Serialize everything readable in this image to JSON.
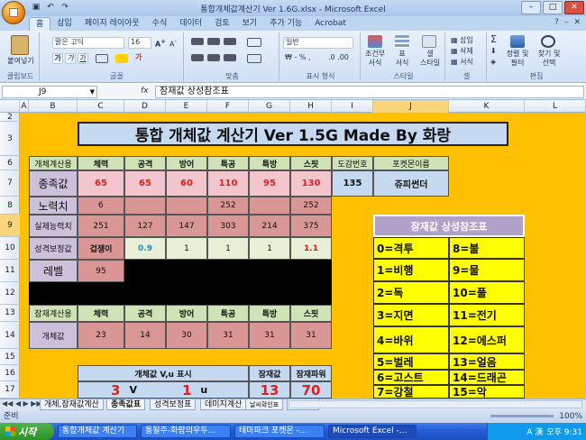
{
  "window": {
    "title": "통합개체값계산기 Ver 1.6G.xlsx - Microsoft Excel"
  },
  "ribbon": {
    "tabs": [
      "홈",
      "삽입",
      "페이지 레이아웃",
      "수식",
      "데이터",
      "검토",
      "보기",
      "추가 기능",
      "Acrobat"
    ],
    "active_tab": "홈",
    "clipboard": {
      "paste": "붙여넣기",
      "label": "클립보드"
    },
    "font": {
      "name": "맑은 고딕",
      "size": "16",
      "label": "글꼴"
    },
    "alignment": {
      "label": "맞춤"
    },
    "number": {
      "format": "일반",
      "label": "표시 형식"
    },
    "style": {
      "conditional": "조건부\n서식",
      "table": "표\n서식",
      "cell": "셀\n스타일",
      "label": "스타일"
    },
    "cells": {
      "insert": "삽입",
      "delete": "삭제",
      "format": "서식",
      "label": "셀"
    },
    "edit": {
      "sort": "정렬 및\n필터",
      "find": "찾기 및\n선택",
      "label": "편집"
    }
  },
  "formula_bar": {
    "cell_ref": "J9",
    "fx": "fx",
    "content": "잠재값 상성참조표"
  },
  "columns": [
    "A",
    "B",
    "C",
    "D",
    "E",
    "F",
    "G",
    "H",
    "I",
    "J",
    "K",
    "L"
  ],
  "selected_column": "J",
  "rows": [
    "2",
    "3",
    "6",
    "7",
    "8",
    "9",
    "10",
    "11",
    "12",
    "13",
    "14",
    "15",
    "16",
    "17"
  ],
  "selected_row": "9",
  "sheet": {
    "title": "통합 개체값 계산기   Ver 1.5G   Made By 화랑",
    "header_row": {
      "label": "개체계산용",
      "cols": [
        "체력",
        "공격",
        "방어",
        "특공",
        "특방",
        "스핏"
      ],
      "dex_no": "도감번호",
      "poke_name": "포켓몬이름"
    },
    "species": {
      "label": "종족값",
      "values": [
        "65",
        "65",
        "60",
        "110",
        "95",
        "130"
      ],
      "dex_no": "135",
      "poke_name": "쥬피썬더"
    },
    "effort": {
      "label": "노력치",
      "values": [
        "6",
        "",
        "",
        "252",
        "",
        "252"
      ]
    },
    "actual": {
      "label": "실제능력치",
      "values": [
        "251",
        "127",
        "147",
        "303",
        "214",
        "375"
      ]
    },
    "nature": {
      "label": "성격보정값",
      "name": "겁쟁이",
      "values": [
        "0.9",
        "1",
        "1",
        "1",
        "1.1"
      ]
    },
    "level": {
      "label": "레벨",
      "value": "95"
    },
    "potential_header": {
      "label": "잠재계산용",
      "cols": [
        "체력",
        "공격",
        "방어",
        "특공",
        "특방",
        "스핏"
      ]
    },
    "iv": {
      "label": "개체값",
      "values": [
        "23",
        "14",
        "30",
        "31",
        "31",
        "31"
      ]
    },
    "vu": {
      "label": "개체값 V,u 표시",
      "v_count": "3",
      "v": "V",
      "u_count": "1",
      "u": "u"
    },
    "potential": {
      "label": "잠재값",
      "value": "13"
    },
    "potential_power": {
      "label": "잠재파워",
      "value": "70"
    },
    "reftable": {
      "title": "잠재값 상성참조표",
      "left": [
        "0=격투",
        "1=비행",
        "2=독",
        "3=지면",
        "4=바위",
        "5=벌레",
        "6=고스트",
        "7=강철"
      ],
      "right": [
        "8=불",
        "9=물",
        "10=풀",
        "11=전기",
        "12=에스퍼",
        "13=얼음",
        "14=드래곤",
        "15=악"
      ]
    }
  },
  "sheet_tabs": [
    "개체,잠재값계산",
    "종족값표",
    "성격보정표",
    "데미지계산",
    "날씨확인표",
    "잠재파워"
  ],
  "active_sheet_tab": "종족값표",
  "status": {
    "ready": "준비",
    "zoom": "100%"
  },
  "taskbar": {
    "start": "시작",
    "items": [
      "통합개체값 계산기",
      "통될주-화랑의우두...",
      "테마파크 포켓몬 -...",
      "Microsoft Excel -..."
    ],
    "active": "Microsoft Excel -...",
    "tray_lang": "A 漢",
    "clock": "오후 9:31"
  },
  "colors": {
    "sheet_bg": "#ffc000",
    "accent": "#e02020",
    "ref_yellow": "#ffff00"
  }
}
